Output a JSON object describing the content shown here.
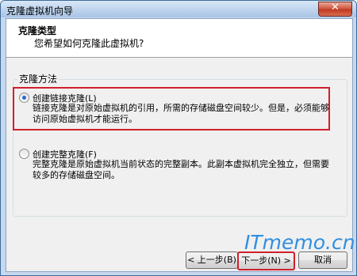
{
  "window": {
    "title": "克隆虚拟机向导"
  },
  "header": {
    "title": "克隆类型",
    "subtitle": "您希望如何克隆此虚拟机?"
  },
  "group": {
    "label": "克隆方法"
  },
  "options": [
    {
      "label": "创建链接克隆(L)",
      "selected": true,
      "desc": "链接克隆是对原始虚拟机的引用，所需的存储磁盘空间较少。但是，必须能够访问原始虚拟机才能运行。"
    },
    {
      "label": "创建完整克隆(F)",
      "selected": false,
      "desc": "完整克隆是原始虚拟机当前状态的完整副本。此副本虚拟机完全独立，但需要较多的存储磁盘空间。"
    }
  ],
  "buttons": {
    "back": "< 上一步(B)",
    "next": "下一步(N) >",
    "cancel": "取消"
  },
  "watermark": "ITmemo.cn"
}
